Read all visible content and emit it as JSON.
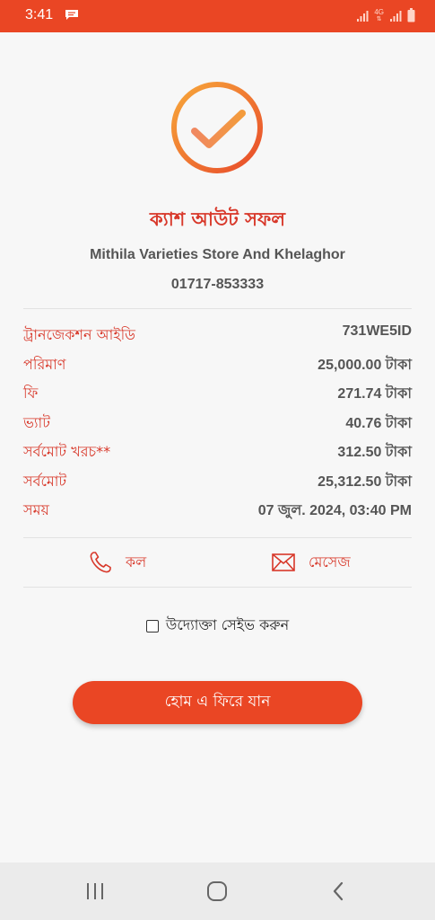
{
  "status_bar": {
    "time": "3:41",
    "icons": [
      "message-icon",
      "signal-icon",
      "4g-icon",
      "signal-icon",
      "battery-icon"
    ],
    "network_label": "4G"
  },
  "result": {
    "icon": "check-circle-icon",
    "title": "ক্যাশ আউট সফল",
    "merchant_name": "Mithila Varieties Store And Khelaghor",
    "merchant_phone": "01717-853333"
  },
  "details": [
    {
      "label": "ট্রানজেকশন আইডি",
      "value": "731WE5ID"
    },
    {
      "label": "পরিমাণ",
      "value": "25,000.00 টাকা"
    },
    {
      "label": "ফি",
      "value": "271.74 টাকা"
    },
    {
      "label": "ভ্যাট",
      "value": "40.76 টাকা"
    },
    {
      "label": "সর্বমোট খরচ**",
      "value": "312.50 টাকা"
    },
    {
      "label": "সর্বমোট",
      "value": "25,312.50 টাকা"
    },
    {
      "label": "সময়",
      "value": "07 জুল. 2024, 03:40 PM"
    }
  ],
  "actions": {
    "call_label": "কল",
    "call_icon": "phone-icon",
    "message_label": "মেসেজ",
    "message_icon": "envelope-icon"
  },
  "save_entrepreneur": {
    "label": "উদ্যোক্তা সেইভ করুন",
    "checked": false
  },
  "home_button": {
    "label": "হোম এ ফিরে যান"
  },
  "nav": {
    "icons": [
      "recent-apps-icon",
      "home-icon",
      "back-icon"
    ]
  },
  "colors": {
    "accent": "#ea4624",
    "title_red": "#d8382a",
    "check_gradient_start": "#f6a13a",
    "check_gradient_end": "#e94f2b",
    "text_gray": "#555555",
    "background": "#f7f7f7"
  }
}
